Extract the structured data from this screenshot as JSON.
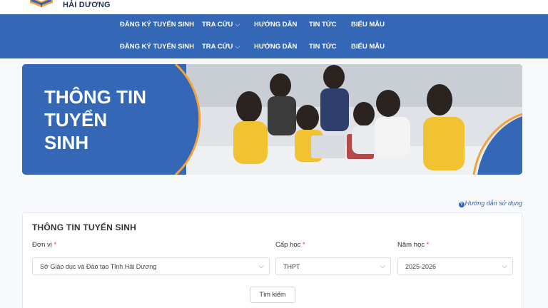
{
  "header": {
    "logo_text": "HẢI DƯƠNG"
  },
  "nav": {
    "rows": [
      {
        "items": [
          {
            "label": "ĐĂNG KÝ TUYỂN SINH",
            "dropdown": false
          },
          {
            "label": "TRA CỨU",
            "dropdown": true
          },
          {
            "label": "HƯỚNG DẪN",
            "dropdown": false
          },
          {
            "label": "TIN TỨC",
            "dropdown": false
          },
          {
            "label": "BIỂU MẪU",
            "dropdown": false
          }
        ]
      },
      {
        "items": [
          {
            "label": "ĐĂNG KÝ TUYỂN SINH",
            "dropdown": false
          },
          {
            "label": "TRA CỨU",
            "dropdown": true
          },
          {
            "label": "HƯỚNG DẪN",
            "dropdown": false
          },
          {
            "label": "TIN TỨC",
            "dropdown": false
          },
          {
            "label": "BIỂU MẪU",
            "dropdown": false
          }
        ]
      }
    ],
    "chevron_icon": "chevron-down-icon"
  },
  "banner": {
    "title_lines": [
      "THÔNG TIN",
      "TUYỂN",
      "SINH"
    ]
  },
  "help_link": {
    "icon": "question-circle-icon",
    "label": "Hướng dẫn sử dụng"
  },
  "form": {
    "title": "THÔNG TIN TUYỂN SINH",
    "fields": [
      {
        "label": "Đơn vị",
        "required_mark": "*",
        "value": "Sở Giáo dục và Đào tạo Tỉnh Hải Dương"
      },
      {
        "label": "Cấp học",
        "required_mark": "*",
        "value": "THPT"
      },
      {
        "label": "Năm học",
        "required_mark": "*",
        "value": "2025-2026"
      }
    ],
    "search_button": "Tìm kiếm"
  },
  "colors": {
    "primary": "#3467b6",
    "accent_orange": "#f2a23a",
    "required": "#e04040"
  }
}
